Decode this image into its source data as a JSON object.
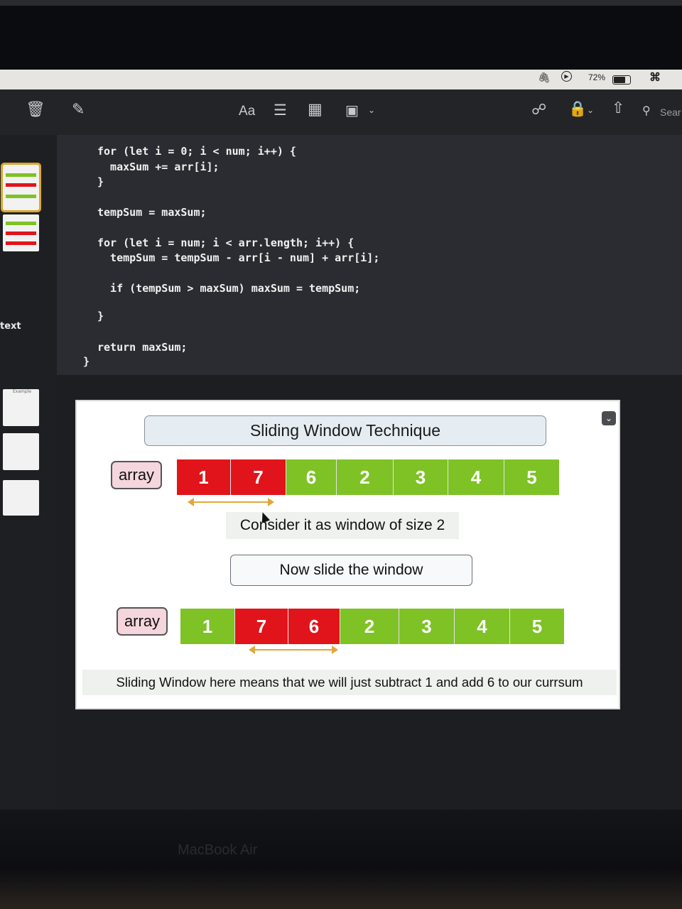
{
  "menubar": {
    "battery": "72%"
  },
  "toolbar": {
    "font_label": "Aa",
    "search_label": "Sear"
  },
  "sidebar": {
    "label": "text",
    "thumb_label": "Example"
  },
  "code": {
    "lines": [
      "for (let i = 0; i < num; i++) {",
      "  maxSum += arr[i];",
      "}",
      "tempSum = maxSum;",
      "for (let i = num; i < arr.length; i++) {",
      "  tempSum = tempSum - arr[i - num] + arr[i];",
      "  if (tempSum > maxSum) maxSum = tempSum;",
      "}",
      "return maxSum;",
      "}"
    ]
  },
  "slide": {
    "title": "Sliding Window Technique",
    "array_label": "array",
    "row1": [
      {
        "v": "1",
        "c": "#e1141b"
      },
      {
        "v": "7",
        "c": "#e1141b"
      },
      {
        "v": "6",
        "c": "#7ec225"
      },
      {
        "v": "2",
        "c": "#7ec225"
      },
      {
        "v": "3",
        "c": "#7ec225"
      },
      {
        "v": "4",
        "c": "#7ec225"
      },
      {
        "v": "5",
        "c": "#7ec225"
      }
    ],
    "row2": [
      {
        "v": "1",
        "c": "#7ec225"
      },
      {
        "v": "7",
        "c": "#e1141b"
      },
      {
        "v": "6",
        "c": "#e1141b"
      },
      {
        "v": "2",
        "c": "#7ec225"
      },
      {
        "v": "3",
        "c": "#7ec225"
      },
      {
        "v": "4",
        "c": "#7ec225"
      },
      {
        "v": "5",
        "c": "#7ec225"
      }
    ],
    "caption1": "Consider it as window of size 2",
    "caption2": "Now slide the window",
    "caption3": "Sliding Window here means that we will just subtract 1 and add 6 to our currsum"
  },
  "bezel": {
    "label": "MacBook Air"
  },
  "colors": {
    "red": "#e1141b",
    "green": "#7ec225",
    "arrow": "#e3a63a"
  }
}
